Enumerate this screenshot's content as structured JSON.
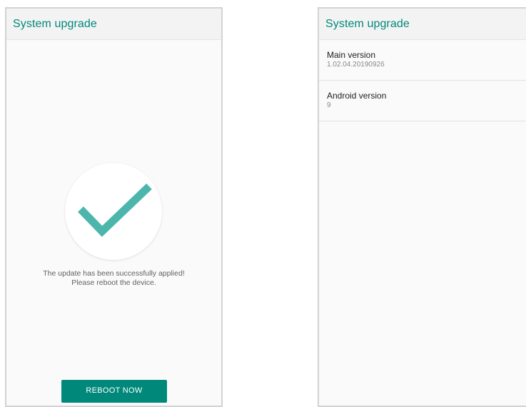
{
  "left_screen": {
    "app_bar": {
      "title": "System upgrade"
    },
    "status": {
      "icon": "check-icon",
      "message_line1": "The update has been successfully applied!",
      "message_line2": "Please reboot the device."
    },
    "reboot_button": {
      "label": "REBOOT NOW"
    }
  },
  "right_screen": {
    "app_bar": {
      "title": "System upgrade"
    },
    "items": [
      {
        "title": "Main version",
        "summary": "1.02.04.20190926"
      },
      {
        "title": "Android version",
        "summary": "9"
      }
    ]
  },
  "colors": {
    "accent": "#00897b",
    "check": "#4db6ac"
  }
}
